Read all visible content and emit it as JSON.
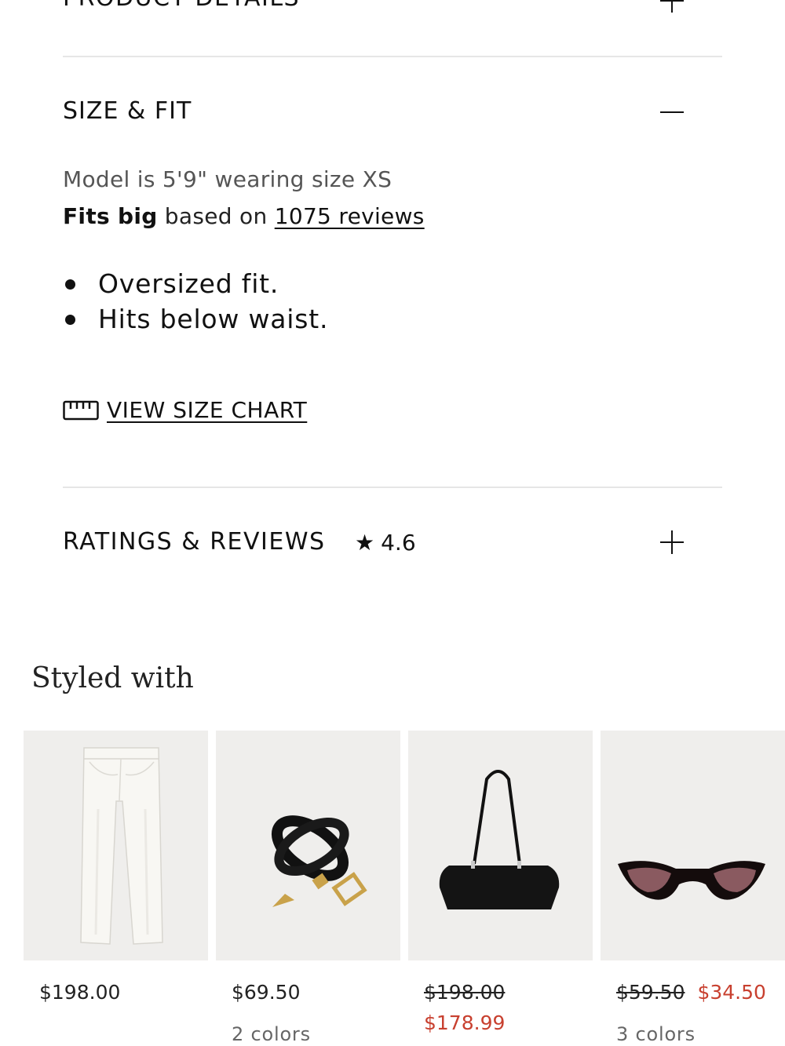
{
  "product_details": {
    "title": "PRODUCT DETAILS"
  },
  "size_fit": {
    "title": "SIZE & FIT",
    "model_text": "Model is 5'9\" wearing size XS",
    "fit_bold": "Fits big",
    "fit_mid": " based on ",
    "reviews_link": "1075 reviews",
    "bullets": [
      "Oversized fit.",
      "Hits below waist."
    ],
    "size_chart_label": "VIEW SIZE CHART"
  },
  "ratings": {
    "title": "RATINGS & REVIEWS",
    "star": "★",
    "score": "4.6"
  },
  "styled_with": {
    "title": "Styled with",
    "products": [
      {
        "name": "white-jeans",
        "price": "$198.00",
        "original_price": "",
        "sale_price": "",
        "colors": ""
      },
      {
        "name": "black-belt",
        "price": "$69.50",
        "original_price": "",
        "sale_price": "",
        "colors": "2 colors"
      },
      {
        "name": "black-suede-bag",
        "price": "",
        "original_price": "$198.00",
        "sale_price": "$178.99",
        "colors": ""
      },
      {
        "name": "cat-eye-sunglasses",
        "price": "",
        "original_price": "$59.50",
        "sale_price": "$34.50",
        "colors": "3 colors"
      }
    ]
  },
  "colors": {
    "text": "#111111",
    "muted": "#666666",
    "sale": "#c8402f",
    "divider": "#e6e6e6",
    "image_bg": "#efeeec"
  }
}
